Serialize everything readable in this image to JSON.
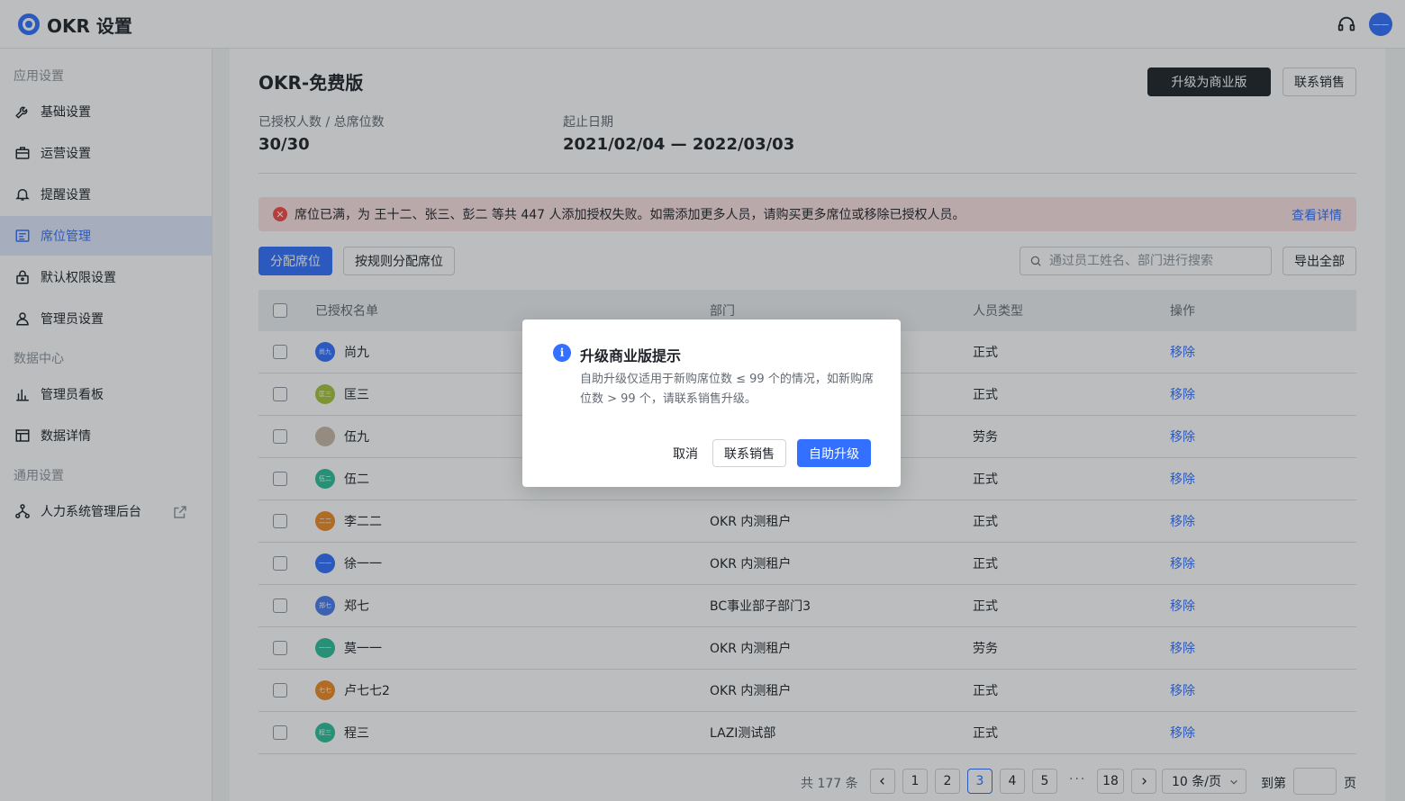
{
  "app": {
    "title": "OKR 设置"
  },
  "sidebar": {
    "groups": [
      "应用设置",
      "数据中心",
      "通用设置"
    ],
    "items": [
      {
        "label": "基础设置",
        "icon": "wrench-icon"
      },
      {
        "label": "运营设置",
        "icon": "briefcase-icon"
      },
      {
        "label": "提醒设置",
        "icon": "bell-icon"
      },
      {
        "label": "席位管理",
        "icon": "seat-list-icon",
        "active": true
      },
      {
        "label": "默认权限设置",
        "icon": "lock-icon"
      },
      {
        "label": "管理员设置",
        "icon": "user-icon"
      },
      {
        "label": "管理员看板",
        "icon": "bar-chart-icon"
      },
      {
        "label": "数据详情",
        "icon": "table-icon"
      },
      {
        "label": "人力系统管理后台",
        "icon": "org-chart-icon"
      }
    ]
  },
  "header": {
    "avatar_label": "一一",
    "plan_title": "OKR-免费版",
    "upgrade_label": "升级为商业版",
    "contact_label": "联系销售",
    "seats_label": "已授权人数 / 总席位数",
    "seats_value": "30/30",
    "date_label": "起止日期",
    "date_value": "2021/02/04 — 2022/03/03"
  },
  "alert": {
    "message": "席位已满，为 王十二、张三、彭二 等共 447 人添加授权失败。如需添加更多人员，请购买更多席位或移除已授权人员。",
    "link": "查看详情",
    "icon_glyph": "✕"
  },
  "toolbar": {
    "assign_label": "分配席位",
    "rule_assign_label": "按规则分配席位",
    "search_placeholder": "通过员工姓名、部门进行搜索",
    "export_label": "导出全部"
  },
  "table": {
    "headers": [
      "已授权名单",
      "部门",
      "人员类型",
      "操作"
    ],
    "rows": [
      {
        "name": "尚九",
        "avatar": "尚九",
        "color": "#3370ff",
        "dept": "",
        "type": "正式",
        "action": "移除"
      },
      {
        "name": "匡三",
        "avatar": "匡三",
        "color": "#a6c43a",
        "dept": "",
        "type": "正式",
        "action": "移除"
      },
      {
        "name": "伍九",
        "avatar": "",
        "color": "#c9b8a8",
        "dept": "",
        "type": "劳务",
        "action": "移除"
      },
      {
        "name": "伍二",
        "avatar": "伍二",
        "color": "#2bbf9a",
        "dept": "",
        "type": "正式",
        "action": "移除"
      },
      {
        "name": "李二二",
        "avatar": "二二",
        "color": "#f08a24",
        "dept": "OKR 内测租户",
        "type": "正式",
        "action": "移除"
      },
      {
        "name": "徐一一",
        "avatar": "一一",
        "color": "#3370ff",
        "dept": "OKR 内测租户",
        "type": "正式",
        "action": "移除"
      },
      {
        "name": "郑七",
        "avatar": "郑七",
        "color": "#4a7cf0",
        "dept": "BC事业部子部门3",
        "type": "正式",
        "action": "移除"
      },
      {
        "name": "莫一一",
        "avatar": "一一",
        "color": "#2bbf9a",
        "dept": "OKR 内测租户",
        "type": "劳务",
        "action": "移除"
      },
      {
        "name": "卢七七2",
        "avatar": "七七",
        "color": "#f08a24",
        "dept": "OKR 内测租户",
        "type": "正式",
        "action": "移除"
      },
      {
        "name": "程三",
        "avatar": "程三",
        "color": "#2bbf9a",
        "dept": "LAZI测试部",
        "type": "正式",
        "action": "移除"
      }
    ]
  },
  "pagination": {
    "total": "共 177 条",
    "pages": [
      "1",
      "2",
      "3",
      "4",
      "5"
    ],
    "current": "3",
    "ellipsis": "···",
    "last": "18",
    "page_size": "10 条/页",
    "jump_prefix": "到第",
    "jump_suffix": "页"
  },
  "modal": {
    "icon_glyph": "i",
    "title": "升级商业版提示",
    "body": "自助升级仅适用于新购席位数 ≤ 99 个的情况，如新购席位数 > 99 个，请联系销售升级。",
    "cancel": "取消",
    "contact": "联系销售",
    "confirm": "自助升级"
  }
}
